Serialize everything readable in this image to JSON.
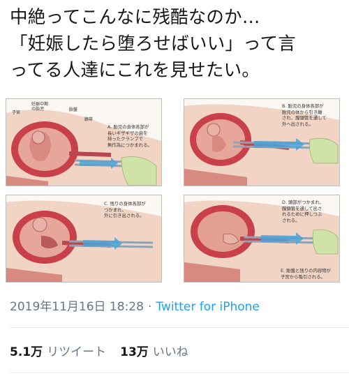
{
  "tweet": {
    "lines": [
      "中絶ってこんなに残酷なのか…",
      "「妊娠したら堕ろせばいい」って言",
      "ってる人達にこれを見せたい。"
    ]
  },
  "illustration": {
    "labels": {
      "uterus": "子宮",
      "fetus": "妊娠中期\nの胎児",
      "placenta": "胎盤",
      "cord": "臍帯"
    },
    "panels": [
      {
        "text": "A. 胎児の身体各部が\n長いギザギザの歯を\n持ったクランプで\n無作為につかまれる。"
      },
      {
        "text": "B. 胎児の身体各部が\n胎児の体から引き離\nされ、膣頸管を通して\n外へ出される。"
      },
      {
        "text": "C. 残りの身体各部が\nつかまれ、\n外に引き出される。"
      },
      {
        "text": "D. 頭部がつかまれ、\n膣頸管を通して出さ\nれるために押しつぶ\nされる。"
      },
      {
        "text": "E. 胎盤と残りの内容物が\n子宮から吸引される。"
      }
    ]
  },
  "meta": {
    "timestamp": "2019年11月16日 18:28",
    "separator": "·",
    "source": "Twitter for iPhone"
  },
  "stats": {
    "retweets_count": "5.1万",
    "retweets_label": "リツイート",
    "likes_count": "13万",
    "likes_label": "いいね"
  },
  "colors": {
    "link": "#1da1f2",
    "muted": "#657786",
    "uterus": "#c8404a",
    "tissue": "#e6a79a",
    "instrument": "#8fa3b3",
    "arrow": "#4aa3d8"
  }
}
